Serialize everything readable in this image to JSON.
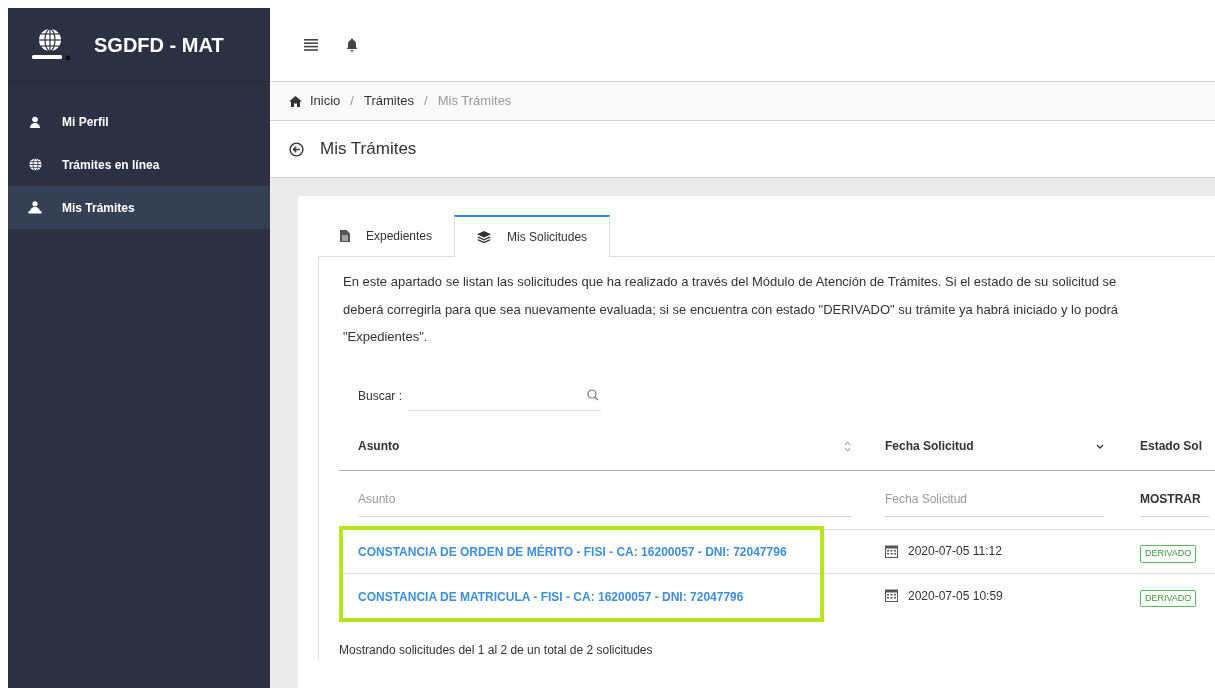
{
  "sidebar": {
    "brand": "SGDFD - MAT",
    "items": [
      {
        "label": "Mi Perfil",
        "selected": false
      },
      {
        "label": "Trámites en línea",
        "selected": false
      },
      {
        "label": "Mis Trámites",
        "selected": true
      }
    ]
  },
  "breadcrumb": [
    {
      "label": "Inicio",
      "current": false
    },
    {
      "label": "Trámites",
      "current": false
    },
    {
      "label": "Mis Trámites",
      "current": true
    }
  ],
  "separator": "/",
  "page_title": "Mis Trámites",
  "tabs": [
    {
      "label": "Expedientes",
      "selected": false
    },
    {
      "label": "Mis Solicitudes",
      "selected": true
    }
  ],
  "description_lines": [
    "En este apartado se listan las solicitudes que ha realizado a través del Módulo de Atención de Trámites. Si el estado de su solicitud se",
    "deberá corregirla para que sea nuevamente evaluada; si se encuentra con estado \"DERIVADO\" su trámite ya habrá iniciado y lo podrá",
    "\"Expedientes\"."
  ],
  "search": {
    "label": "Buscar :"
  },
  "table": {
    "columns": [
      "Asunto",
      "Fecha Solicitud",
      "Estado Sol"
    ],
    "filters": [
      {
        "kind": "input",
        "placeholder": "Asunto"
      },
      {
        "kind": "input",
        "placeholder": "Fecha Solicitud"
      },
      {
        "kind": "select",
        "value": "MOSTRAR"
      }
    ],
    "rows": [
      {
        "asunto": "CONSTANCIA DE ORDEN DE MÉRITO - FISI - CA: 16200057 - DNI: 72047796",
        "fecha": "2020-07-05 11:12",
        "estado": "DERIVADO",
        "highlighted": true
      },
      {
        "asunto": "CONSTANCIA DE MATRICULA - FISI - CA: 16200057 - DNI: 72047796",
        "fecha": "2020-07-05 10:59",
        "estado": "DERIVADO",
        "highlighted": true
      }
    ]
  },
  "footer": "Mostrando solicitudes del 1 al 2 de un total de 2 solicitudes"
}
